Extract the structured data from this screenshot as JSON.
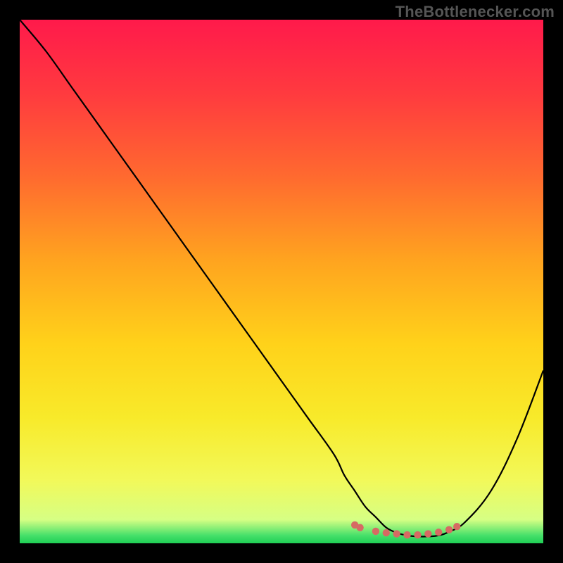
{
  "attribution": "TheBottlenecker.com",
  "chart_data": {
    "type": "line",
    "title": "",
    "xlabel": "",
    "ylabel": "",
    "xlim": [
      0,
      100
    ],
    "ylim": [
      0,
      100
    ],
    "series": [
      {
        "name": "bottleneck-curve",
        "x": [
          0,
          5,
          10,
          15,
          20,
          25,
          30,
          35,
          40,
          45,
          50,
          55,
          60,
          62,
          64,
          66,
          68,
          70,
          72,
          74,
          76,
          78,
          80,
          82,
          85,
          90,
          95,
          100
        ],
        "values": [
          100,
          94,
          87,
          80,
          73,
          66,
          59,
          52,
          45,
          38,
          31,
          24,
          17,
          13,
          10,
          7,
          5,
          3,
          2,
          1.5,
          1.3,
          1.3,
          1.5,
          2.2,
          4,
          10,
          20,
          33
        ]
      }
    ],
    "markers": {
      "name": "optimal-range",
      "color": "#d66a63",
      "points": [
        {
          "x": 64,
          "y": 3.5
        },
        {
          "x": 65,
          "y": 3.0
        },
        {
          "x": 68,
          "y": 2.3
        },
        {
          "x": 70,
          "y": 2.0
        },
        {
          "x": 72,
          "y": 1.8
        },
        {
          "x": 74,
          "y": 1.6
        },
        {
          "x": 76,
          "y": 1.6
        },
        {
          "x": 78,
          "y": 1.8
        },
        {
          "x": 80,
          "y": 2.1
        },
        {
          "x": 82,
          "y": 2.6
        },
        {
          "x": 83.5,
          "y": 3.2
        }
      ]
    },
    "gradient_stops": [
      {
        "offset": 0.0,
        "color": "#ff1a4b"
      },
      {
        "offset": 0.14,
        "color": "#ff3a3f"
      },
      {
        "offset": 0.3,
        "color": "#ff6a2f"
      },
      {
        "offset": 0.46,
        "color": "#ffa41f"
      },
      {
        "offset": 0.62,
        "color": "#ffd21a"
      },
      {
        "offset": 0.76,
        "color": "#f8ea2a"
      },
      {
        "offset": 0.88,
        "color": "#f2f95a"
      },
      {
        "offset": 0.955,
        "color": "#d6ff84"
      },
      {
        "offset": 0.985,
        "color": "#46e06a"
      },
      {
        "offset": 1.0,
        "color": "#1fcf55"
      }
    ]
  }
}
